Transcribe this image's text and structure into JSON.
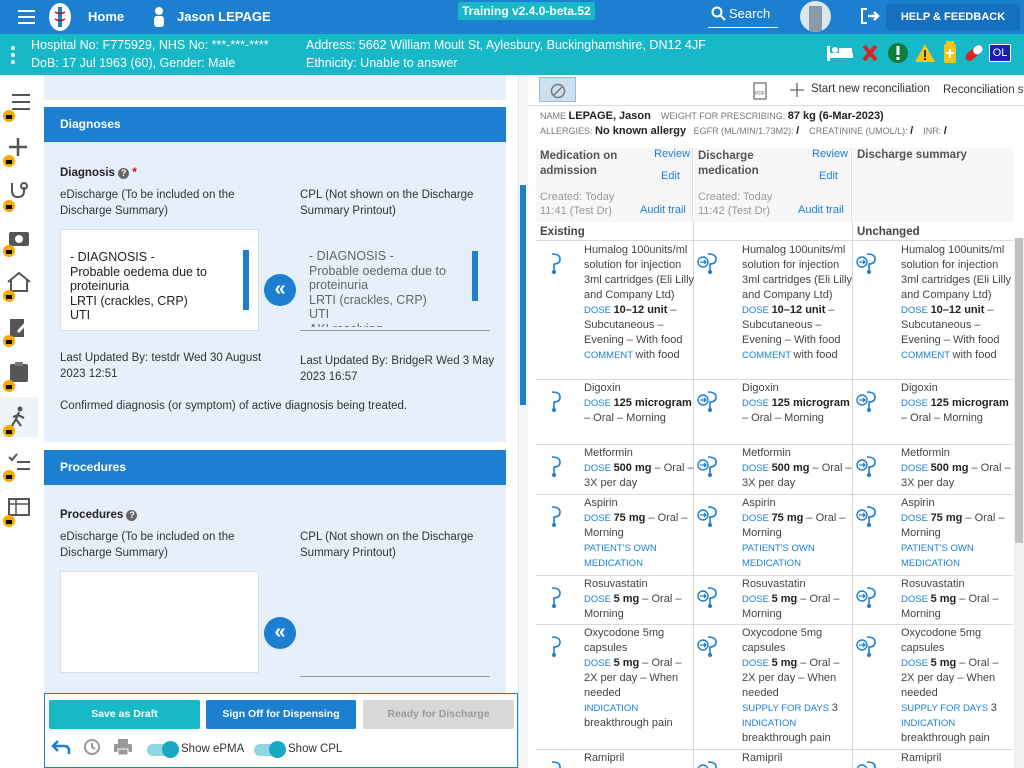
{
  "topbar": {
    "home": "Home",
    "user": "Jason LEPAGE",
    "version": "Training v2.4.0-beta.52",
    "search": "Search",
    "help": "HELP & FEEDBACK",
    "user_initials": "OL"
  },
  "patient": {
    "hospital": "Hospital No: F775929, NHS No: ***-***-****",
    "dob": "DoB: 17 Jul 1963 (60), Gender: Male",
    "address": "Address: 5662 William Moult St, Aylesbury, Buckinghamshire, DN12 4JF",
    "ethnicity": "Ethnicity: Unable to answer"
  },
  "diagnoses": {
    "title": "Diagnoses",
    "label": "Diagnosis",
    "required": "*",
    "ed_label": "eDischarge (To be included on the Discharge Summary)",
    "cpl_label": "CPL (Not shown on the Discharge Summary Printout)",
    "ed_text": "- DIAGNOSIS -\nProbable oedema due to proteinuria\nLRTI (crackles, CRP)\nUTI",
    "cpl_text": "- DIAGNOSIS -\nProbable oedema due to proteinuria\nLRTI (crackles, CRP)\nUTI\nAKI resolving",
    "ed_updated": "Last Updated By: testdr Wed 30 August 2023 12:51",
    "cpl_updated": "Last Updated By: BridgeR Wed 3 May 2023 16:57",
    "note": "Confirmed diagnosis (or symptom) of active diagnosis being treated."
  },
  "procedures": {
    "title": "Procedures",
    "label": "Procedures",
    "ed_label": "eDischarge (To be included on the Discharge Summary)",
    "cpl_label": "CPL (Not shown on the Discharge Summary Printout)"
  },
  "actions": {
    "save": "Save as Draft",
    "signoff": "Sign Off for Dispensing",
    "ready": "Ready for Discharge",
    "show_epma": "Show ePMA",
    "show_cpl": "Show CPL"
  },
  "reconciliation": {
    "start": "Start new reconciliation",
    "status": "Reconciliation st",
    "name_k": "NAME",
    "name": "LEPAGE, Jason",
    "weight_k": "WEIGHT FOR PRESCRIBING:",
    "weight": "87 kg (6-Mar-2023)",
    "allergies_k": "ALLERGIES:",
    "allergies": "No known allergy",
    "egfr_k": "EGFR (ML/MIN/1.73M2):",
    "egfr": "/",
    "creat_k": "CREATININE (UMOL/L):",
    "creat": "/",
    "inr_k": "INR:",
    "inr": "/",
    "col1_title": "Medication on admission",
    "col1_review": "Review",
    "col1_edit": "Edit",
    "col1_created": "Created: Today",
    "col1_time": "11:41 (Test Dr)",
    "col1_audit": "Audit trail",
    "col2_title": "Discharge medication",
    "col2_review": "Review",
    "col2_edit": "Edit",
    "col2_created": "Created: Today",
    "col2_time": "11:42 (Test Dr)",
    "col2_audit": "Audit trail",
    "col3_title": "Discharge summary",
    "sec_existing": "Existing",
    "sec_unchanged": "Unchanged"
  },
  "meds": [
    {
      "name": "Humalog 100units/ml solution for injection 3ml cartridges (Eli Lilly and Company Ltd)",
      "dose_k": "DOSE",
      "dose": "10–12 unit",
      "route": "– Subcutaneous – Evening – With food",
      "extra_k": "COMMENT",
      "extra": "with food"
    },
    {
      "name": "Digoxin",
      "dose_k": "DOSE",
      "dose": "125 microgram",
      "route": "– Oral – Morning",
      "extra_k": "",
      "extra": ""
    },
    {
      "name": "Metformin",
      "dose_k": "DOSE",
      "dose": "500 mg",
      "route": "– Oral – 3X per day",
      "extra_k": "",
      "extra": ""
    },
    {
      "name": "Aspirin",
      "dose_k": "DOSE",
      "dose": "75 mg",
      "route": "– Oral – Morning",
      "extra_k": "PATIENT'S OWN MEDICATION",
      "extra": ""
    },
    {
      "name": "Rosuvastatin",
      "dose_k": "DOSE",
      "dose": "5 mg",
      "route": "– Oral – Morning",
      "extra_k": "",
      "extra": ""
    },
    {
      "name": "Oxycodone 5mg capsules",
      "dose_k": "DOSE",
      "dose": "5 mg",
      "route": "– Oral – 2X per day – When needed",
      "extra_k": "INDICATION",
      "extra": "breakthrough pain",
      "supply_k": "SUPPLY FOR DAYS",
      "supply": "3"
    },
    {
      "name": "Ramipril",
      "dose_k": "",
      "dose": "",
      "route": "",
      "extra_k": "",
      "extra": ""
    }
  ]
}
